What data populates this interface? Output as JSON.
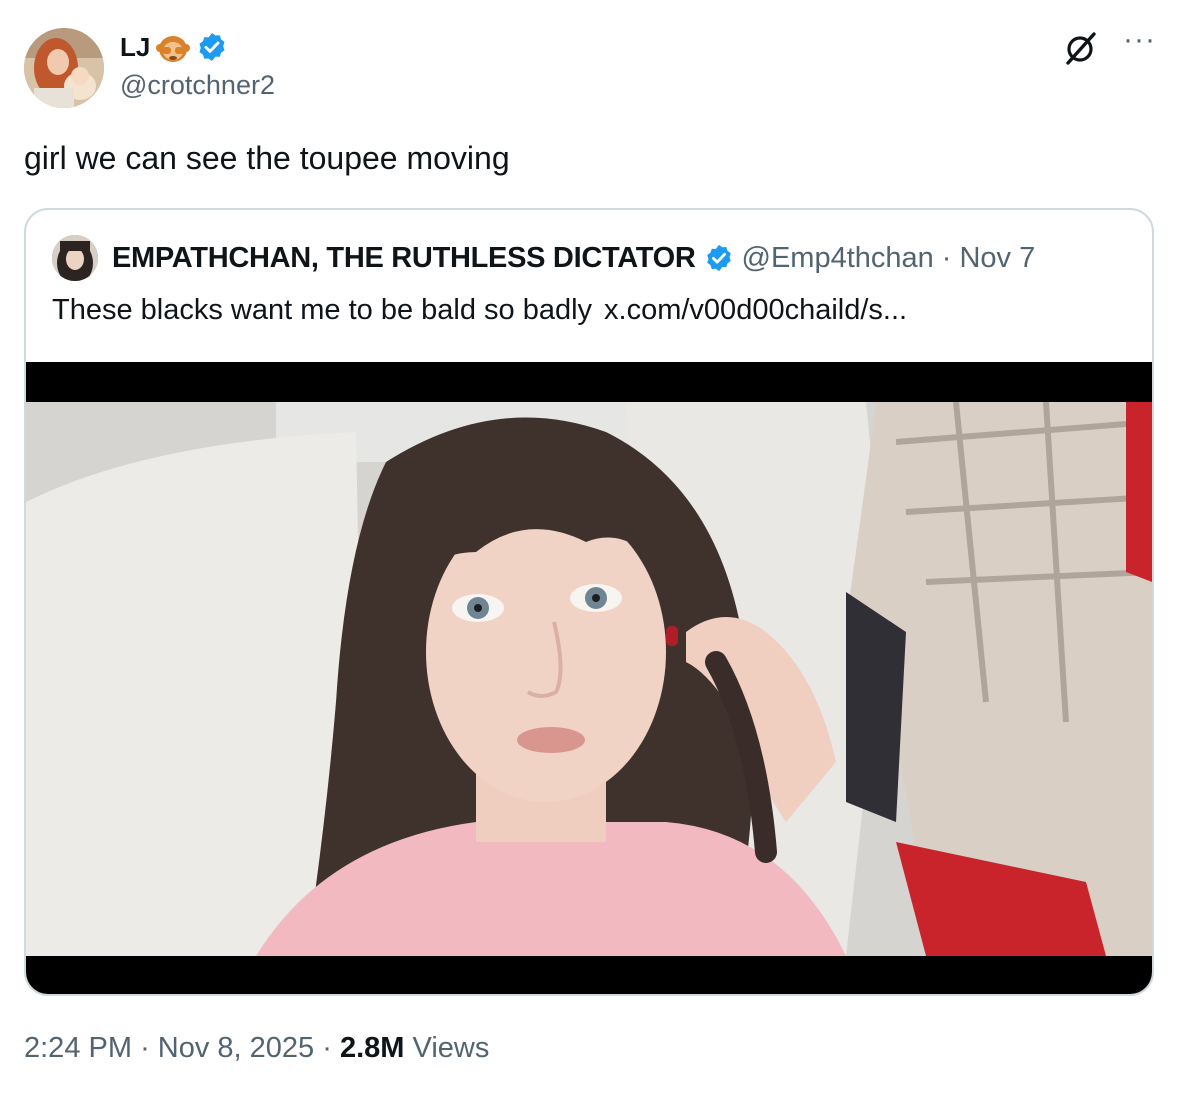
{
  "author": {
    "name": "LJ",
    "handle": "@crotchner2"
  },
  "tweet": {
    "text": "girl we can see the toupee moving"
  },
  "quoted": {
    "name": "EMPATHCHAN, THE RUTHLESS DICTATOR",
    "handle": "@Emp4thchan",
    "separator": "·",
    "date": "Nov 7",
    "text": "These blacks want me to be bald so badly",
    "link": "x.com/v00d00chaild/s..."
  },
  "footer": {
    "time": "2:24 PM",
    "sep1": "·",
    "date": "Nov 8, 2025",
    "sep2": "·",
    "views_count": "2.8M",
    "views_label": "Views"
  },
  "icons": {
    "verified": "verified-badge-icon",
    "grok": "grok-icon",
    "more": "more-icon"
  },
  "colors": {
    "verified": "#1d9bf0",
    "secondary_text": "#536471",
    "primary_text": "#0f1419",
    "border": "#cfd9de"
  }
}
